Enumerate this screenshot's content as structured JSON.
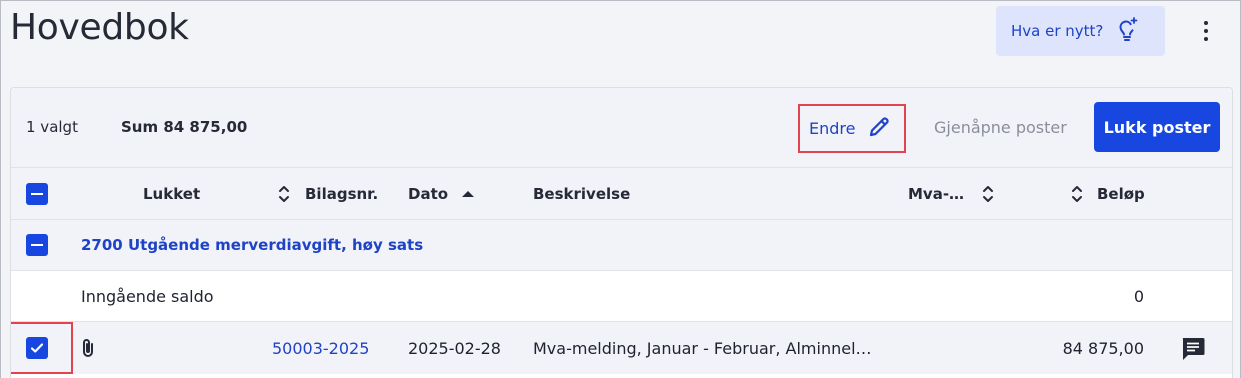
{
  "page": {
    "title": "Hovedbok",
    "whats_new_label": "Hva er nytt?",
    "more_icon": "kebab-vertical-icon"
  },
  "toolbar": {
    "selected_count": "1 valgt",
    "sum_label": "Sum 84 875,00",
    "edit_label": "Endre",
    "reopen_label": "Gjenåpne poster",
    "close_label": "Lukk poster"
  },
  "table": {
    "columns": {
      "closed": "Lukket",
      "voucher": "Bilagsnr.",
      "date": "Dato",
      "description": "Beskrivelse",
      "vat": "Mva-…",
      "amount": "Beløp"
    },
    "group": {
      "label": "2700 Utgående merverdiavgift, høy sats"
    },
    "opening_balance": {
      "label": "Inngående saldo",
      "amount": "0"
    },
    "rows": [
      {
        "voucher": "50003-2025",
        "date": "2025-02-28",
        "description": "Mva-melding, Januar - Februar, Alminnel…",
        "amount": "84 875,00",
        "checked": true
      }
    ]
  },
  "colors": {
    "accent": "#1747e0",
    "link": "#1f43c6",
    "highlight": "#e2434e"
  }
}
